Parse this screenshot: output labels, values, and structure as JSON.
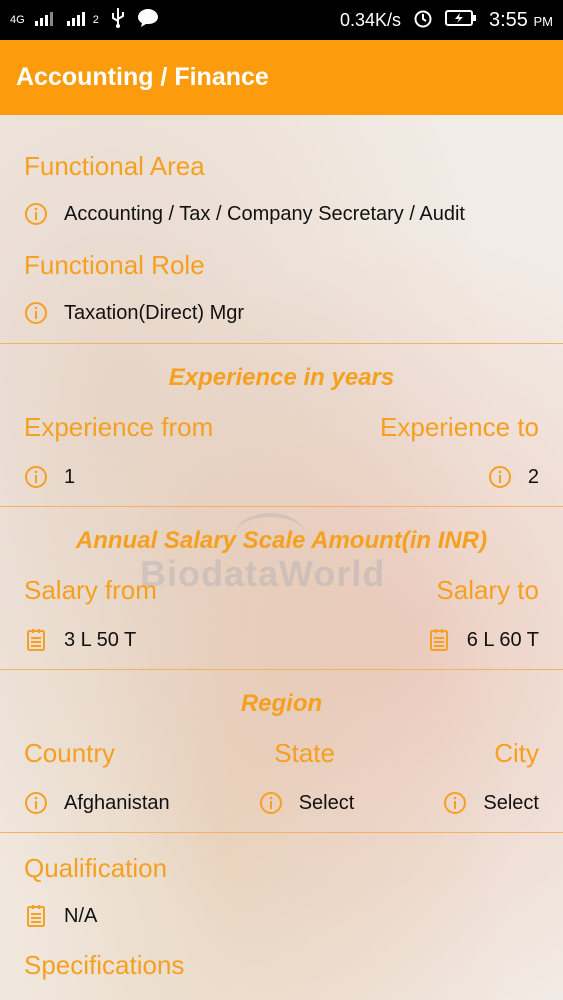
{
  "status_bar": {
    "network_label": "4G",
    "sim2_label": "2",
    "speed": "0.34K/s",
    "time": "3:55",
    "ampm": "PM"
  },
  "app_bar": {
    "title": "Accounting / Finance"
  },
  "functional_area": {
    "label": "Functional Area",
    "value": "Accounting / Tax / Company Secretary / Audit"
  },
  "functional_role": {
    "label": "Functional Role",
    "value": "Taxation(Direct) Mgr"
  },
  "experience": {
    "title": "Experience in years",
    "from_label": "Experience from",
    "to_label": "Experience to",
    "from_value": "1",
    "to_value": "2"
  },
  "salary": {
    "title": "Annual Salary Scale Amount(in INR)",
    "from_label": "Salary from",
    "to_label": "Salary to",
    "from_value": "3 L 50 T",
    "to_value": "6 L 60 T"
  },
  "region": {
    "title": "Region",
    "country_label": "Country",
    "state_label": "State",
    "city_label": "City",
    "country_value": "Afghanistan",
    "state_value": "Select",
    "city_value": "Select"
  },
  "qualification": {
    "label": "Qualification",
    "value": "N/A"
  },
  "specifications": {
    "label": "Specifications"
  },
  "watermark": {
    "text": "BiodataWorld"
  },
  "colors": {
    "accent": "#fc9c0c",
    "label": "#f5a020",
    "divider": "#f5b060"
  },
  "icons": {
    "info": "info-circle-icon",
    "note": "notepad-icon"
  }
}
